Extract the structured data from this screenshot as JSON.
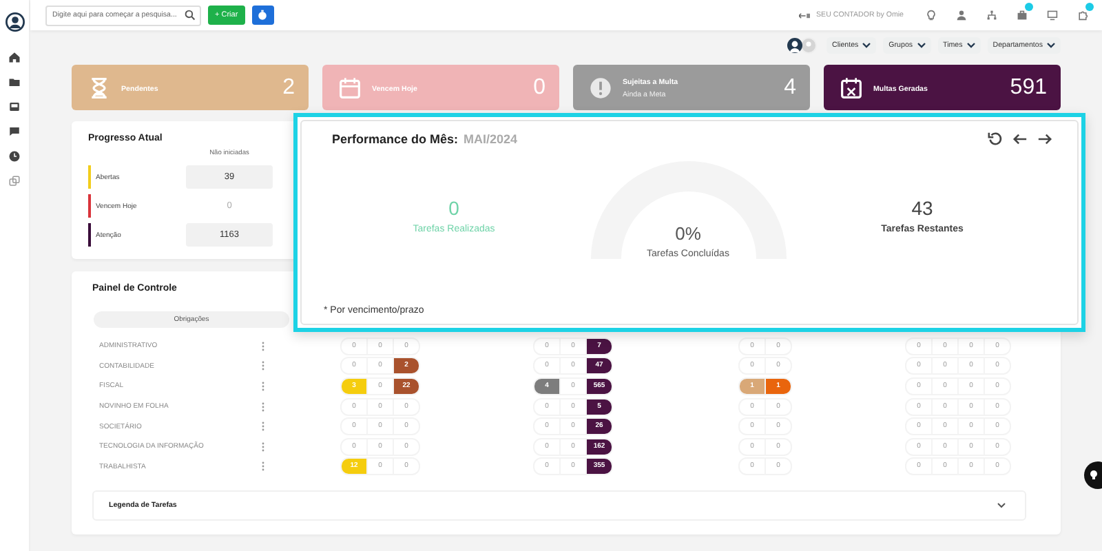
{
  "topbar": {
    "search": {
      "placeholder": "Digite aqui para começar a pesquisa..."
    },
    "create_button": "+ Criar",
    "account": "SEU CONTADOR by Omie",
    "icons": [
      {
        "kind": "bulb",
        "badge": false
      },
      {
        "kind": "user",
        "badge": false
      },
      {
        "kind": "network",
        "badge": false
      },
      {
        "kind": "briefcase",
        "badge": true
      },
      {
        "kind": "monitor",
        "badge": false
      },
      {
        "kind": "puzzle",
        "badge": true
      }
    ]
  },
  "filters": [
    "Clientes",
    "Grupos",
    "Times",
    "Departamentos"
  ],
  "stat_cards": [
    {
      "kind": "hourglass",
      "label": "Pendentes",
      "value": "2",
      "color": "#dfb88e"
    },
    {
      "kind": "calendar",
      "label": "Vencem Hoje",
      "value": "0",
      "color": "#f0b4b6"
    },
    {
      "kind": "alert",
      "label": "Sujeitas a Multa",
      "subtitle": "Ainda a Meta",
      "value": "4",
      "color": "#9b9b9b"
    },
    {
      "kind": "calendar-x",
      "label": "Multas Geradas",
      "value": "591",
      "color": "#4b1343"
    }
  ],
  "progress": {
    "title": "Progresso Atual",
    "column": "Não iniciadas",
    "rows": [
      {
        "label": "Abertas",
        "value": "39",
        "color": "#f2cd1c",
        "faded": false
      },
      {
        "label": "Vencem Hoje",
        "value": "0",
        "color": "#d9343b",
        "faded": true
      },
      {
        "label": "Atenção",
        "value": "1163",
        "color": "#3a0d3a",
        "faded": false
      }
    ]
  },
  "panel": {
    "title": "Painel de Controle",
    "column": "Obrigações",
    "rows": [
      {
        "name": "ADMINISTRATIVO",
        "groups": [
          [
            {
              "value": "0"
            },
            {
              "value": "0"
            },
            {
              "value": "0"
            }
          ],
          [
            {
              "value": "0"
            },
            {
              "value": "0"
            },
            {
              "value": "7",
              "color": "#4b1343"
            }
          ],
          [
            {
              "value": "0"
            },
            {
              "value": "0"
            }
          ],
          [
            {
              "value": "0"
            },
            {
              "value": "0"
            },
            {
              "value": "0"
            },
            {
              "value": "0"
            }
          ]
        ]
      },
      {
        "name": "CONTABILIDADE",
        "groups": [
          [
            {
              "value": "0"
            },
            {
              "value": "0"
            },
            {
              "value": "2",
              "color": "#a9522d"
            }
          ],
          [
            {
              "value": "0"
            },
            {
              "value": "0"
            },
            {
              "value": "47",
              "color": "#4b1343"
            }
          ],
          [
            {
              "value": "0"
            },
            {
              "value": "0"
            }
          ],
          [
            {
              "value": "0"
            },
            {
              "value": "0"
            },
            {
              "value": "0"
            },
            {
              "value": "0"
            }
          ]
        ]
      },
      {
        "name": "FISCAL",
        "groups": [
          [
            {
              "value": "3",
              "color": "#f5cd0e"
            },
            {
              "value": "0"
            },
            {
              "value": "22",
              "color": "#a9522d"
            }
          ],
          [
            {
              "value": "4",
              "color": "#7d7d7d"
            },
            {
              "value": "0"
            },
            {
              "value": "565",
              "color": "#4b1343"
            }
          ],
          [
            {
              "value": "1",
              "color": "#d9a877"
            },
            {
              "value": "1",
              "color": "#e9650d"
            }
          ],
          [
            {
              "value": "0"
            },
            {
              "value": "0"
            },
            {
              "value": "0"
            },
            {
              "value": "0"
            }
          ]
        ]
      },
      {
        "name": "NOVINHO EM FOLHA",
        "groups": [
          [
            {
              "value": "0"
            },
            {
              "value": "0"
            },
            {
              "value": "0"
            }
          ],
          [
            {
              "value": "0"
            },
            {
              "value": "0"
            },
            {
              "value": "5",
              "color": "#4b1343"
            }
          ],
          [
            {
              "value": "0"
            },
            {
              "value": "0"
            }
          ],
          [
            {
              "value": "0"
            },
            {
              "value": "0"
            },
            {
              "value": "0"
            },
            {
              "value": "0"
            }
          ]
        ]
      },
      {
        "name": "SOCIETÁRIO",
        "groups": [
          [
            {
              "value": "0"
            },
            {
              "value": "0"
            },
            {
              "value": "0"
            }
          ],
          [
            {
              "value": "0"
            },
            {
              "value": "0"
            },
            {
              "value": "26",
              "color": "#4b1343"
            }
          ],
          [
            {
              "value": "0"
            },
            {
              "value": "0"
            }
          ],
          [
            {
              "value": "0"
            },
            {
              "value": "0"
            },
            {
              "value": "0"
            },
            {
              "value": "0"
            }
          ]
        ]
      },
      {
        "name": "TECNOLOGIA DA INFORMAÇÃO",
        "groups": [
          [
            {
              "value": "0"
            },
            {
              "value": "0"
            },
            {
              "value": "0"
            }
          ],
          [
            {
              "value": "0"
            },
            {
              "value": "0"
            },
            {
              "value": "162",
              "color": "#4b1343"
            }
          ],
          [
            {
              "value": "0"
            },
            {
              "value": "0"
            }
          ],
          [
            {
              "value": "0"
            },
            {
              "value": "0"
            },
            {
              "value": "0"
            },
            {
              "value": "0"
            }
          ]
        ]
      },
      {
        "name": "TRABALHISTA",
        "groups": [
          [
            {
              "value": "12",
              "color": "#f5cd0e"
            },
            {
              "value": "0"
            },
            {
              "value": "0"
            }
          ],
          [
            {
              "value": "0"
            },
            {
              "value": "0"
            },
            {
              "value": "355",
              "color": "#4b1343"
            }
          ],
          [
            {
              "value": "0"
            },
            {
              "value": "0"
            }
          ],
          [
            {
              "value": "0"
            },
            {
              "value": "0"
            },
            {
              "value": "0"
            },
            {
              "value": "0"
            }
          ]
        ]
      }
    ],
    "legend": {
      "title": "Legenda de Tarefas",
      "expanded": false
    }
  },
  "performance": {
    "title": "Performance do Mês:",
    "period": "MAI/2024",
    "done": {
      "value": "0",
      "label": "Tarefas Realizadas"
    },
    "gauge": {
      "value": "0%",
      "label": "Tarefas Concluídas"
    },
    "remaining": {
      "value": "43",
      "label": "Tarefas Restantes"
    },
    "note": "* Por vencimento/prazo"
  }
}
